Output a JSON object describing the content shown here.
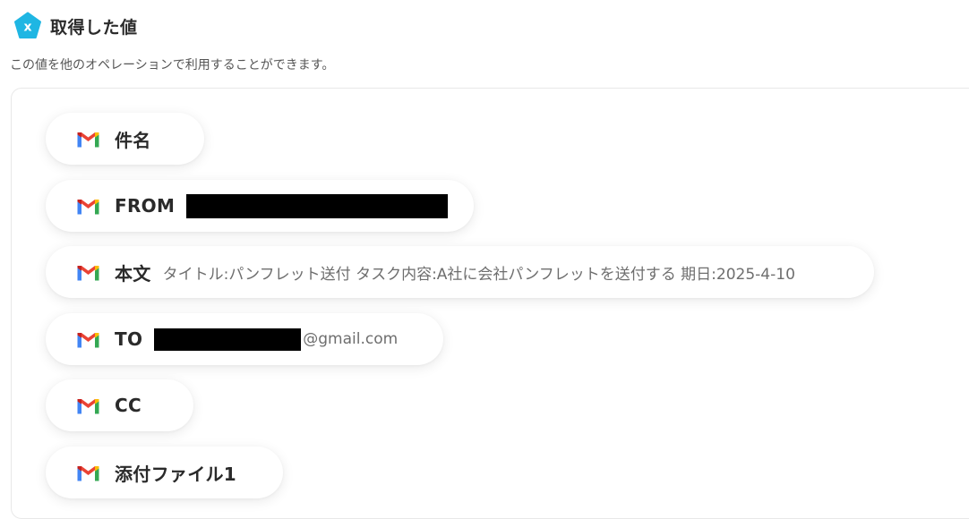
{
  "header": {
    "badge_letter": "x",
    "title": "取得した値",
    "subtitle": "この値を他のオペレーションで利用することができます。"
  },
  "fields": {
    "subject": {
      "label": "件名",
      "icon": "gmail-icon"
    },
    "from": {
      "label": "FROM",
      "value_redacted": true,
      "icon": "gmail-icon"
    },
    "body": {
      "label": "本文",
      "value": "タイトル:パンフレット送付 タスク内容:A社に会社パンフレットを送付する 期日:2025-4-10",
      "icon": "gmail-icon"
    },
    "to": {
      "label": "TO",
      "value_suffix": "@gmail.com",
      "icon": "gmail-icon"
    },
    "cc": {
      "label": "CC",
      "icon": "gmail-icon"
    },
    "attachment": {
      "label": "添付ファイル1",
      "icon": "gmail-icon"
    }
  },
  "colors": {
    "badge": "#1fb6e3",
    "gmail_red": "#ea4335",
    "gmail_blue": "#4285f4",
    "gmail_green": "#34a853",
    "gmail_yellow": "#fbbc04",
    "gmail_darkred": "#c5221f"
  }
}
